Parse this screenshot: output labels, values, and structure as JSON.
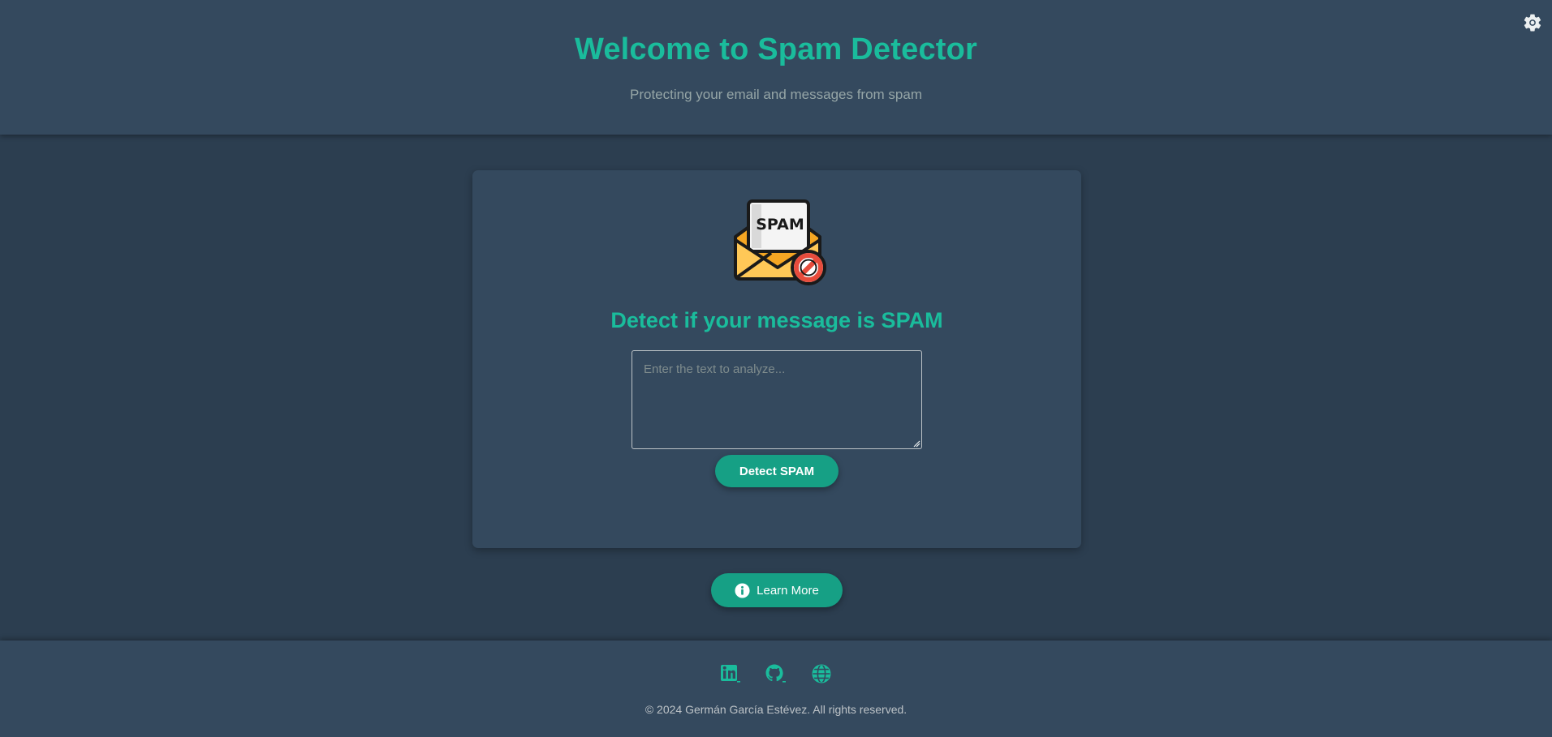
{
  "header": {
    "title": "Welcome to Spam Detector",
    "subtitle": "Protecting your email and messages from spam",
    "settings_icon": "gear-icon"
  },
  "card": {
    "logo_icon": "spam-envelope-icon",
    "logo_text": "SPAM",
    "heading": "Detect if your message is SPAM",
    "textarea": {
      "placeholder": "Enter the text to analyze...",
      "value": ""
    },
    "detect_button": "Detect SPAM"
  },
  "learn_more": {
    "label": "Learn More",
    "icon": "info-circle-icon"
  },
  "footer": {
    "social_icons": [
      "linkedin-icon",
      "github-icon",
      "globe-icon"
    ],
    "copyright": "© 2024 Germán García Estévez. All rights reserved."
  },
  "colors": {
    "accent": "#1abc9c",
    "button": "#16a085",
    "background": "#2c3e50",
    "panel": "#34495e"
  }
}
